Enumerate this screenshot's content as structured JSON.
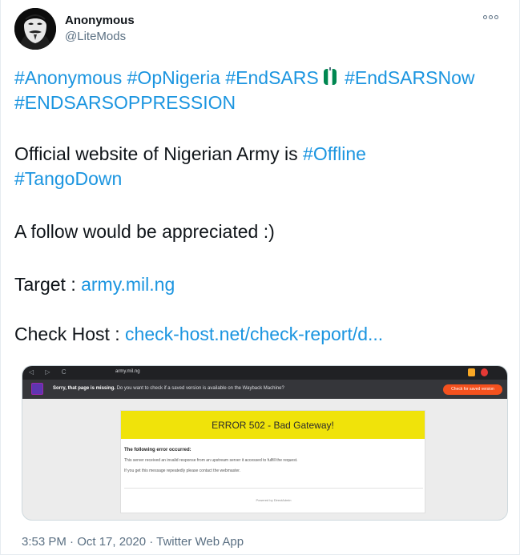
{
  "user": {
    "name": "Anonymous",
    "handle": "@LiteMods"
  },
  "tweet": {
    "line1": {
      "tag1": "#Anonymous",
      "tag2": "#OpNigeria",
      "tag3": "#EndSARS",
      "tag4": "#EndSARSNow"
    },
    "line2": {
      "tag": "#ENDSARSOPPRESSION"
    },
    "line3": {
      "text": "Official website of Nigerian Army is ",
      "tag": "#Offline"
    },
    "line4": {
      "tag": "#TangoDown"
    },
    "line5": {
      "text": "A follow would be appreciated :)"
    },
    "line6": {
      "label": "Target : ",
      "link": "army.mil.ng"
    },
    "line7": {
      "label": "Check Host : ",
      "link": "check-host.net/check-report/d..."
    }
  },
  "media": {
    "browser_url": "army.mil.ng",
    "banner_bold": "Sorry, that page is missing.",
    "banner_text": " Do you want to check if a saved version is available on the Wayback Machine?",
    "banner_button": "Check for saved version",
    "error_title": "ERROR 502 - Bad Gateway!",
    "following": "The following error occurred:",
    "message1": "This server received an invalid response from an upstream server it accessed to fulfill the request.",
    "message2": "If you get this message repeatedly please contact the webmaster.",
    "footer": "Powered by DirectAdmin"
  },
  "meta": {
    "timestamp": "3:53 PM · Oct 17, 2020 · Twitter Web App"
  },
  "colors": {
    "link": "#1b95e0",
    "secondary_text": "#5b7083",
    "error_yellow": "#f0e30a",
    "flag_green": "#008751"
  },
  "icons": [
    "anonymous-mask-avatar",
    "more-icon",
    "nigeria-flag-emoji"
  ]
}
